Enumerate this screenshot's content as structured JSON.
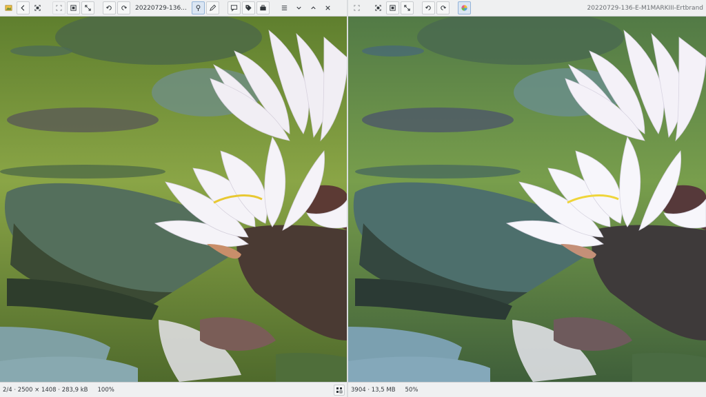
{
  "left_pane": {
    "title": "20220729-136...",
    "status": {
      "position": "2/4",
      "dimensions": "2500 × 1408",
      "filesize": "283,9 kB",
      "zoom": "100%"
    },
    "toolbar_icons": [
      "image-icon",
      "back-icon",
      "fit-icon",
      "crop-icon",
      "resize-icon",
      "rotate-ccw-icon",
      "rotate-cw-icon",
      "pin-icon",
      "pen-icon",
      "comment-icon",
      "tag-icon",
      "briefcase-icon",
      "menu-icon",
      "chevron-down-icon",
      "chevron-up-icon",
      "close-icon"
    ]
  },
  "right_pane": {
    "title": "20220729-136-E-M1MARKIII-Ertbrand",
    "status": {
      "dimensions": "3904",
      "filesize": "13,5 MB",
      "zoom": "50%"
    },
    "toolbar_icons": [
      "image-icon",
      "fit-icon",
      "crop-icon",
      "resize-icon",
      "rotate-ccw-icon",
      "rotate-cw-icon",
      "color-wheel-icon"
    ]
  },
  "colors": {
    "toolbar_bg": "#eff0f1",
    "border": "#c9cccf",
    "accent": "#93b3d8",
    "water_left": "#7d9a3c",
    "water_right": "#6d8f4f"
  }
}
